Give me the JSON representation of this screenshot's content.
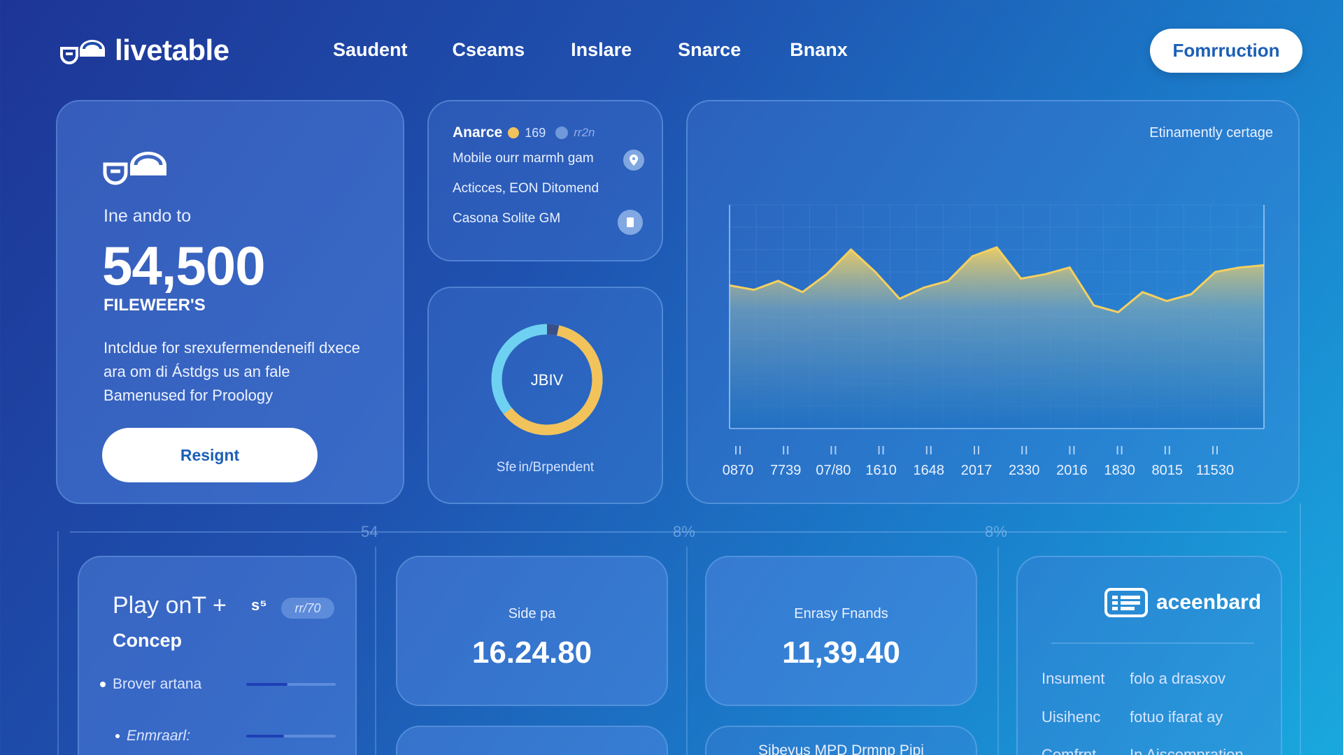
{
  "header": {
    "brand": "livetable",
    "nav": [
      "Saudent",
      "Cseams",
      "Inslare",
      "Snarce",
      "Bnanx"
    ],
    "cta": "Fomrruction"
  },
  "hero": {
    "subtitle": "Ine ando to",
    "value": "54,500",
    "unit": "FILEWEER'S",
    "description": "Intcldue for srexufermendeneifl dхece ara om di Ástdgs us an fale Bamenused for Proology",
    "button": "Resignt"
  },
  "info": {
    "title": "Anarce",
    "legend_a": "169",
    "legend_b": "rr2n",
    "rows": [
      "Mobile ourr marmh gam",
      "Acticces, EON Ditomend",
      "Casona Solite GM"
    ]
  },
  "donut": {
    "center": "JBIV",
    "label": "Sfe in/Brpendent",
    "fraction_yellow": 0.62,
    "colors": {
      "yellow": "#f2c35b",
      "cyan": "#6fd1f1",
      "dark": "#3a4f8a"
    }
  },
  "chart_data": {
    "type": "area",
    "title": "Etinamently certage",
    "x": [
      "0870",
      "7739",
      "07/80",
      "1610",
      "1648",
      "2017",
      "2330",
      "2016",
      "1830",
      "8015",
      "11530"
    ],
    "series": [
      {
        "values": [
          64,
          62,
          66,
          61,
          69,
          80,
          70,
          58,
          63,
          66,
          77,
          81,
          67,
          69,
          72,
          55,
          52,
          61,
          57,
          60,
          70,
          72,
          73
        ]
      }
    ],
    "ylim": [
      0,
      100
    ],
    "colors": {
      "line": "#f4d060",
      "fill_bottom": "#1870c0"
    }
  },
  "divider": {
    "tags": [
      "54",
      "8%",
      "8%"
    ]
  },
  "play": {
    "title": "Play onT +",
    "badge": "s⁵",
    "chip": "rr/70",
    "subtitle": "Concep",
    "items": [
      {
        "label": "Brover artana",
        "progress": 0.46
      },
      {
        "label": "Enmraarl:",
        "progress": 0.42
      }
    ]
  },
  "stats": [
    {
      "label": "Side pa",
      "value": "16.24.80"
    },
    {
      "label": "Enrasy Fnands",
      "value": "11,39.40"
    }
  ],
  "stub_text": "Sibeyus MPD Drmnp Pipi",
  "list": {
    "brand": "aceenbard",
    "rows": [
      {
        "key": "Insument",
        "value": "folo a drasxov"
      },
      {
        "key": "Uisihenc",
        "value": "fotuo ifarat ay"
      },
      {
        "key": "Comfrnt",
        "value": "In Aiscompration"
      }
    ]
  }
}
